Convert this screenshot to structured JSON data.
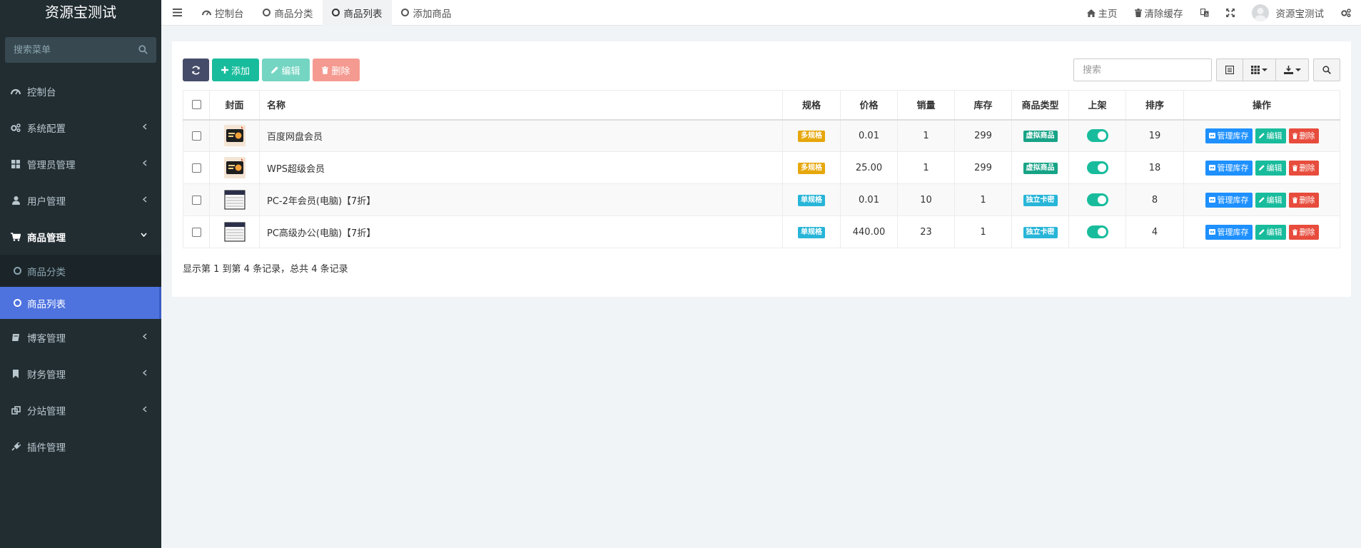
{
  "app": {
    "title": "资源宝测试"
  },
  "sidebar": {
    "search_placeholder": "搜索菜单",
    "items": [
      {
        "label": "控制台",
        "icon": "dashboard-icon"
      },
      {
        "label": "系统配置",
        "icon": "cogs-icon"
      },
      {
        "label": "管理员管理",
        "icon": "windows-icon"
      },
      {
        "label": "用户管理",
        "icon": "user-icon"
      },
      {
        "label": "商品管理",
        "icon": "cart-icon"
      },
      {
        "label": "博客管理",
        "icon": "book-icon"
      },
      {
        "label": "财务管理",
        "icon": "bookmark-icon"
      },
      {
        "label": "分站管理",
        "icon": "clone-icon"
      },
      {
        "label": "插件管理",
        "icon": "plug-icon"
      }
    ],
    "subitems": [
      {
        "label": "商品分类"
      },
      {
        "label": "商品列表"
      }
    ]
  },
  "topbar": {
    "tabs": [
      {
        "label": "控制台"
      },
      {
        "label": "商品分类"
      },
      {
        "label": "商品列表"
      },
      {
        "label": "添加商品"
      }
    ],
    "home_label": "主页",
    "clear_cache_label": "清除缓存",
    "username": "资源宝测试"
  },
  "toolbar": {
    "add_label": "添加",
    "edit_label": "编辑",
    "delete_label": "删除",
    "search_placeholder": "搜索"
  },
  "table": {
    "headers": [
      "封面",
      "名称",
      "规格",
      "价格",
      "销量",
      "库存",
      "商品类型",
      "上架",
      "排序",
      "操作"
    ],
    "rows": [
      {
        "name": "百度网盘会员",
        "spec": "多规格",
        "price": "0.01",
        "sales": "1",
        "stock": "299",
        "type": "虚拟商品",
        "sort": "19",
        "on_shelf": true
      },
      {
        "name": "WPS超级会员",
        "spec": "多规格",
        "price": "25.00",
        "sales": "1",
        "stock": "299",
        "type": "虚拟商品",
        "sort": "18",
        "on_shelf": true
      },
      {
        "name": "PC-2年会员(电脑)【7折】",
        "spec": "单规格",
        "price": "0.01",
        "sales": "10",
        "stock": "1",
        "type": "独立卡密",
        "sort": "8",
        "on_shelf": true
      },
      {
        "name": "PC高级办公(电脑)【7折】",
        "spec": "单规格",
        "price": "440.00",
        "sales": "23",
        "stock": "1",
        "type": "独立卡密",
        "sort": "4",
        "on_shelf": true
      }
    ],
    "op_labels": {
      "stock": "管理库存",
      "edit": "编辑",
      "delete": "删除"
    }
  },
  "pagination": {
    "summary": "显示第 1 到第 4 条记录，总共 4 条记录"
  },
  "colors": {
    "sidebar": "#222d32",
    "accent": "#4e73df",
    "success": "#18bc9c",
    "danger": "#e74c3c",
    "primary": "#1e90ff"
  }
}
